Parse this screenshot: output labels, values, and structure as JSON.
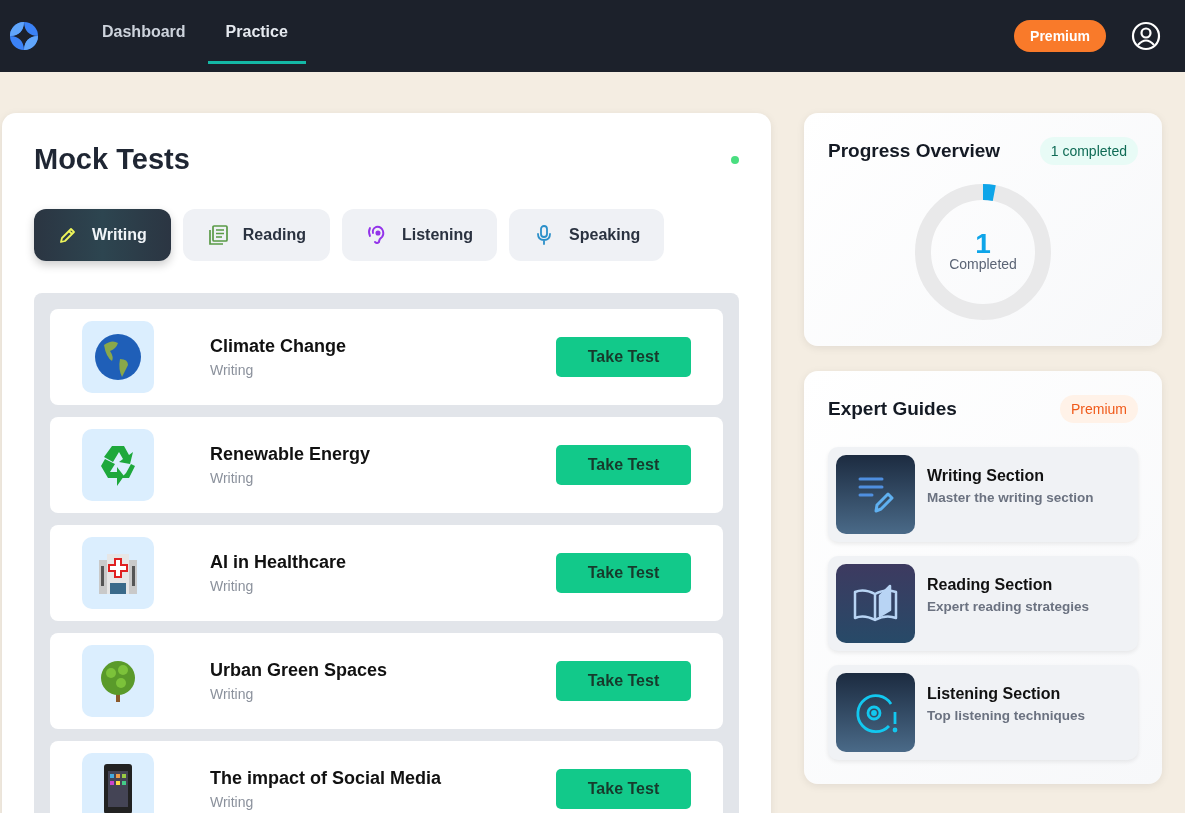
{
  "nav": {
    "links": [
      {
        "label": "Dashboard",
        "selected": false
      },
      {
        "label": "Practice",
        "selected": true
      }
    ],
    "premium_button": "Premium"
  },
  "mock_tests": {
    "title": "Mock Tests",
    "live": true,
    "tabs": [
      {
        "label": "Writing",
        "selected": true
      },
      {
        "label": "Reading",
        "selected": false
      },
      {
        "label": "Listening",
        "selected": false
      },
      {
        "label": "Speaking",
        "selected": false
      }
    ],
    "tests": [
      {
        "title": "Climate Change",
        "section": "Writing",
        "button": "Take Test"
      },
      {
        "title": "Renewable Energy",
        "section": "Writing",
        "button": "Take Test"
      },
      {
        "title": "AI in Healthcare",
        "section": "Writing",
        "button": "Take Test"
      },
      {
        "title": "Urban Green Spaces",
        "section": "Writing",
        "button": "Take Test"
      },
      {
        "title": "The impact of Social Media",
        "section": "Writing",
        "button": "Take Test"
      }
    ]
  },
  "progress": {
    "title": "Progress Overview",
    "badge": "1 completed",
    "level": 0.03,
    "count": "1",
    "caption": "Completed"
  },
  "guides": {
    "title": "Expert Guides",
    "badge": "Premium",
    "items": [
      {
        "title": "Writing Section",
        "subtitle": "Master the writing section"
      },
      {
        "title": "Reading Section",
        "subtitle": "Expert reading strategies"
      },
      {
        "title": "Listening Section",
        "subtitle": "Top listening techniques"
      }
    ]
  }
}
